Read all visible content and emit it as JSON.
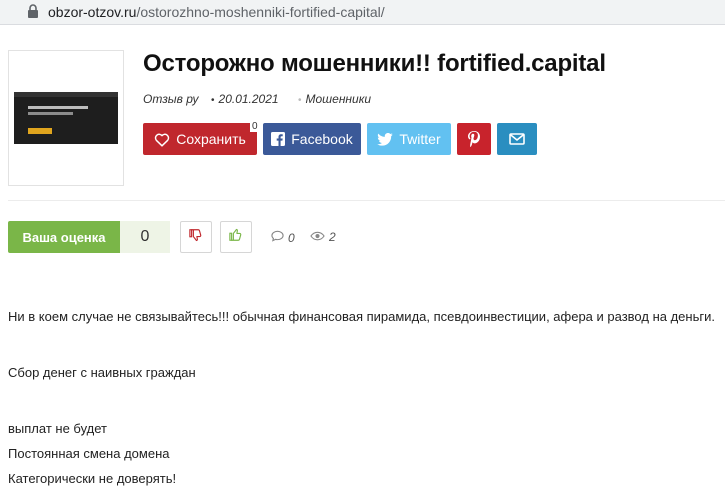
{
  "browser": {
    "url_domain": "obzor-otzov.ru",
    "url_path": "/ostorozhno-moshenniki-fortified-capital/"
  },
  "article": {
    "title": "Осторожно мошенники!! fortified.capital",
    "author": "Отзыв ру",
    "date": "20.01.2021",
    "category": "Мошенники"
  },
  "share": {
    "save_label": "Сохранить",
    "save_count": "0",
    "facebook_label": "Facebook",
    "twitter_label": "Twitter"
  },
  "rating": {
    "label": "Ваша оценка",
    "value": "0",
    "comments_count": "0",
    "views_count": "2"
  },
  "content": {
    "paragraphs": [
      "Ни в коем случае не связывайтесь!!! обычная финансовая пирамида, псевдоинвестиции, афера и развод на деньги.",
      "Сбор денег с наивных граждан",
      "выплат не будет",
      "Постоянная смена домена",
      "Категорически не доверять!"
    ]
  },
  "colors": {
    "save": "#c0272d",
    "facebook": "#3b5998",
    "twitter": "#62c1f1",
    "pinterest": "#c8232c",
    "email": "#2a8ec0",
    "rating_green": "#7ab648"
  }
}
